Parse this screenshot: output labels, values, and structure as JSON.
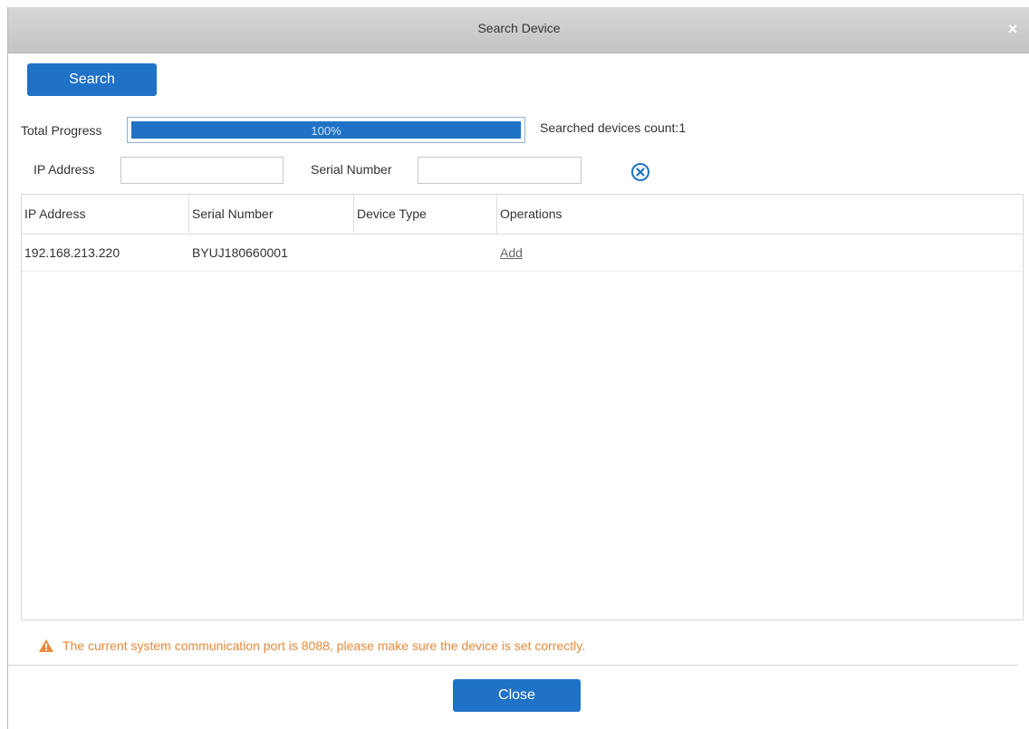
{
  "dialog": {
    "title": "Search Device",
    "close_glyph": "×"
  },
  "toolbar": {
    "search_label": "Search"
  },
  "progress": {
    "label": "Total Progress",
    "percent": 100,
    "text": "100%",
    "count_text": "Searched devices count:1"
  },
  "filters": {
    "ip_label": "IP Address",
    "ip_value": "",
    "serial_label": "Serial Number",
    "serial_value": "",
    "clear_icon": "circle-x-icon"
  },
  "table": {
    "columns": [
      "IP Address",
      "Serial Number",
      "Device Type",
      "Operations"
    ],
    "rows": [
      {
        "ip": "192.168.213.220",
        "serial": "BYUJ180660001",
        "type": "",
        "operation": "Add"
      }
    ]
  },
  "notice": {
    "icon": "warning-icon",
    "text": "The current system communication port is 8088, please make sure the device is set correctly."
  },
  "footer": {
    "close_label": "Close"
  },
  "colors": {
    "accent": "#1f72c6",
    "warning": "#e8893a",
    "title_bar": "#c9c9c9"
  }
}
